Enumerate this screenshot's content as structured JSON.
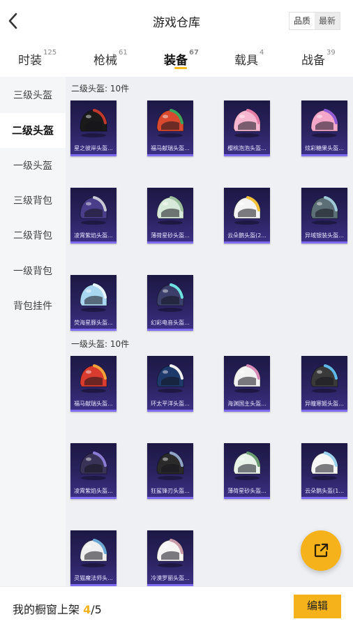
{
  "header": {
    "title": "游戏仓库",
    "sort_quality": "品质",
    "sort_latest": "最新"
  },
  "tabs": [
    {
      "label": "时装",
      "count": "125"
    },
    {
      "label": "枪械",
      "count": "61"
    },
    {
      "label": "装备",
      "count": "67"
    },
    {
      "label": "载具",
      "count": "4"
    },
    {
      "label": "战备",
      "count": "39"
    }
  ],
  "sidebar": {
    "items": [
      "三级头盔",
      "二级头盔",
      "一级头盔",
      "三级背包",
      "二级背包",
      "一级背包",
      "背包挂件"
    ]
  },
  "sections": [
    {
      "title": "二级头盔: 10件",
      "items": [
        {
          "name": "星之彼岸头盔..."
        },
        {
          "name": "福马献瑞头盔..."
        },
        {
          "name": "樱桃泡泡头盔..."
        },
        {
          "name": "炫彩糖果头盔..."
        },
        {
          "name": "凌霄紫焰头盔..."
        },
        {
          "name": "薄荷星砂头盔..."
        },
        {
          "name": "云朵鹅头盔(2..."
        },
        {
          "name": "异域银装头盔..."
        },
        {
          "name": "荧海星豚头盔..."
        },
        {
          "name": "幻彩电音头盔..."
        }
      ]
    },
    {
      "title": "一级头盔: 10件",
      "items": [
        {
          "name": "福马献瑞头盔..."
        },
        {
          "name": "环太平洋头盔..."
        },
        {
          "name": "海渊国主头盔..."
        },
        {
          "name": "异瞳寒姬头盔..."
        },
        {
          "name": "凌霄紫焰头盔..."
        },
        {
          "name": "狂鲨锋刃头盔..."
        },
        {
          "name": "薄荷星砂头盔..."
        },
        {
          "name": "云朵鹅头盔(1..."
        },
        {
          "name": "灵猫魔法师头..."
        },
        {
          "name": "冷漠罗丽头盔..."
        }
      ]
    }
  ],
  "bottom": {
    "label": "我的橱窗上架 ",
    "current": "4",
    "total": "/5",
    "edit_label": "编辑"
  },
  "colors": {
    "accent": "#f6b21a",
    "card_bg": "#2a2360",
    "card_border": "#7d6cf0"
  },
  "icons": {
    "back": "chevron-left-icon",
    "share": "share-external-icon"
  }
}
